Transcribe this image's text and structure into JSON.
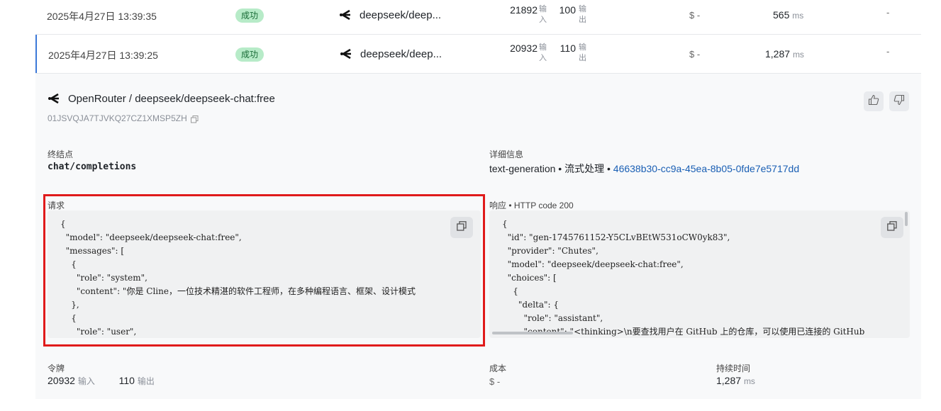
{
  "rows": [
    {
      "date": "2025年4月27日 13:39:35",
      "status": "成功",
      "model": "deepseek/deep...",
      "tokens_in": "21892",
      "in_label_1": "输",
      "in_label_2": "入",
      "tokens_out": "100",
      "out_label_1": "输",
      "out_label_2": "出",
      "cost": "$ -",
      "latency": "565",
      "latency_unit": "ms",
      "extra": "-"
    },
    {
      "date": "2025年4月27日 13:39:25",
      "status": "成功",
      "model": "deepseek/deep...",
      "tokens_in": "20932",
      "in_label_1": "输",
      "in_label_2": "入",
      "tokens_out": "110",
      "out_label_1": "输",
      "out_label_2": "出",
      "cost": "$ -",
      "latency": "1,287",
      "latency_unit": "ms",
      "extra": "-"
    }
  ],
  "detail": {
    "title": "OpenRouter / deepseek/deepseek-chat:free",
    "id": "01JSVQJA7TJVKQ27CZ1XMSP5ZH",
    "endpoint_label": "终结点",
    "endpoint": "chat/completions",
    "info_label": "详细信息",
    "info_type": "text-generation",
    "info_sep": "•",
    "info_stream": "流式处理",
    "info_gen_id": "46638b30-cc9a-45ea-8b05-0fde7e5717dd",
    "request_label": "请求",
    "request_lines": [
      "{",
      "  \"model\": \"deepseek/deepseek-chat:free\",",
      "  \"messages\": [",
      "    {",
      "      \"role\": \"system\",",
      "      \"content\": \"你是 Cline，一位技术精湛的软件工程师，在多种编程语言、框架、设计模式",
      "    },",
      "    {",
      "      \"role\": \"user\","
    ],
    "response_label": "响应 • HTTP code 200",
    "response_lines": [
      "{",
      "  \"id\": \"gen-1745761152-Y5CLvBEtW531oCW0yk83\",",
      "  \"provider\": \"Chutes\",",
      "  \"model\": \"deepseek/deepseek-chat:free\",",
      "  \"choices\": [",
      "    {",
      "      \"delta\": {",
      "        \"role\": \"assistant\",",
      "        \"content\": \"<thinking>\\n要查找用户在 GitHub 上的仓库，可以使用已连接的 GitHub"
    ],
    "tokens_label": "令牌",
    "tokens_in": "20932",
    "tokens_in_unit": "输入",
    "tokens_out": "110",
    "tokens_out_unit": "输出",
    "cost_label": "成本",
    "cost": "$ -",
    "duration_label": "持续时间",
    "duration": "1,287",
    "duration_unit": "ms"
  },
  "colors": {
    "accent": "#3c78d8",
    "success_bg": "#b7ebc8",
    "highlight": "#e01b1b",
    "link": "#1a5fb4"
  }
}
